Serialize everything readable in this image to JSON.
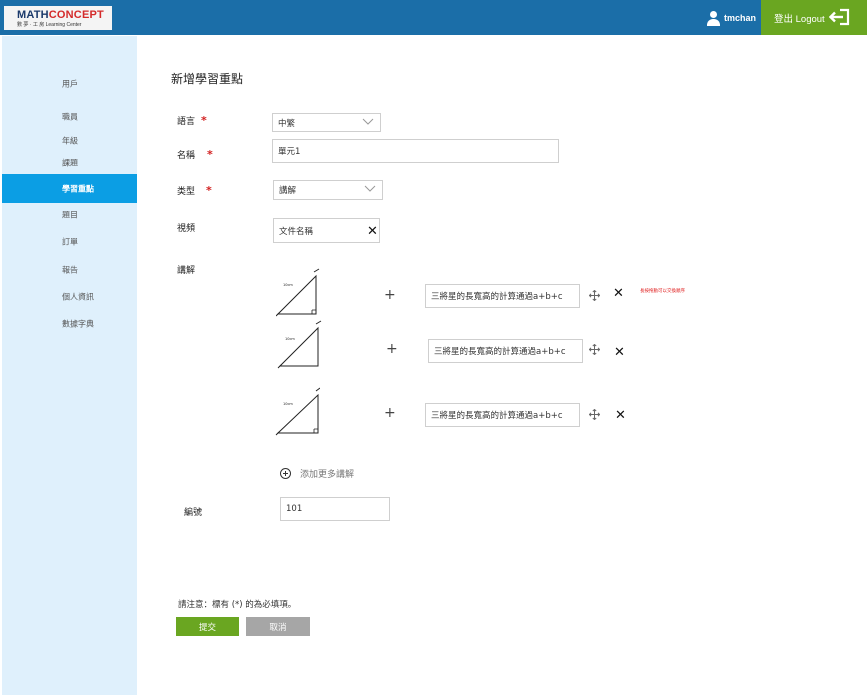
{
  "header": {
    "logo_main_1": "MATH",
    "logo_main_2": "CONCEPT",
    "logo_sub": "數 夢 · 工 房  Learning Center",
    "username": "tmchan",
    "logout_label": "登出 Logout"
  },
  "sidebar": {
    "items": [
      {
        "label": "用戶",
        "active": false
      },
      {
        "label": "職員",
        "active": false
      },
      {
        "label": "年級",
        "active": false
      },
      {
        "label": "課題",
        "active": false
      },
      {
        "label": "學習重點",
        "active": true
      },
      {
        "label": "題目",
        "active": false
      },
      {
        "label": "訂單",
        "active": false
      },
      {
        "label": "報告",
        "active": false
      },
      {
        "label": "個人資訊",
        "active": false
      },
      {
        "label": "數據字典",
        "active": false
      }
    ]
  },
  "main": {
    "title": "新增學習重點",
    "fields": {
      "language": {
        "label": "語言",
        "required": "*",
        "value": "中繁"
      },
      "name": {
        "label": "名稱",
        "required": "*",
        "value": "單元1"
      },
      "type": {
        "label": "类型",
        "required": "*",
        "value": "講解"
      },
      "video": {
        "label": "視頻",
        "value": "文件名稱"
      },
      "explanation": {
        "label": "講解",
        "rows": [
          {
            "triangle_label": "10cm",
            "text": "三將星的長寬高的計算通過a+b+c"
          },
          {
            "triangle_label": "10cm",
            "text": "三將星的長寬高的計算通過a+b+c"
          },
          {
            "triangle_label": "10cm",
            "text": "三將星的長寬高的計算通過a+b+c"
          }
        ],
        "drag_hint": "長按拖動可以交換順序",
        "add_more_label": "添加更多講解"
      },
      "number": {
        "label": "編號",
        "value": "101"
      }
    },
    "note": "請注意：標有 (*) 的為必填項。",
    "submit_label": "提交",
    "cancel_label": "取消"
  },
  "colors": {
    "header_bg": "#1b6ea8",
    "logout_bg": "#6aa621",
    "sidebar_bg": "#dff0fc",
    "sidebar_active": "#0b9ee4",
    "required": "#d21f1f",
    "cancel_bg": "#a6a6a6"
  }
}
